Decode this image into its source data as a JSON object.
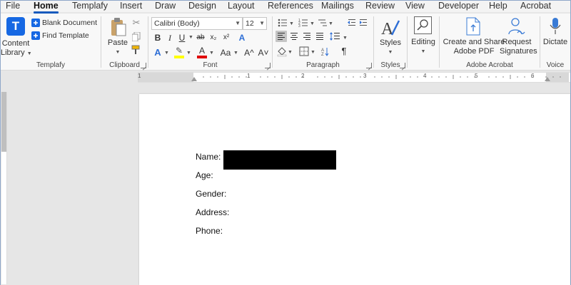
{
  "menu": {
    "tabs": [
      "File",
      "Home",
      "Templafy",
      "Insert",
      "Draw",
      "Design",
      "Layout",
      "References",
      "Mailings",
      "Review",
      "View",
      "Developer",
      "Help",
      "Acrobat"
    ],
    "active": "Home"
  },
  "ribbon": {
    "templafy": {
      "content_library_line1": "Content",
      "content_library_line2": "Library",
      "blank_document": "Blank Document",
      "find_template": "Find Template",
      "group_label": "Templafy"
    },
    "clipboard": {
      "paste": "Paste",
      "group_label": "Clipboard"
    },
    "font": {
      "font_name": "Calibri (Body)",
      "font_size": "12",
      "bold": "B",
      "italic": "I",
      "underline": "U",
      "strike": "ab",
      "subscript": "x₂",
      "superscript": "x²",
      "clear_formatting": "A",
      "text_effects": "A",
      "highlight": "✎",
      "font_color": "A",
      "change_case": "Aa",
      "grow": "A^",
      "shrink": "A˅",
      "group_label": "Font"
    },
    "paragraph": {
      "pilcrow": "¶",
      "group_label": "Paragraph"
    },
    "styles": {
      "label": "Styles",
      "group_label": "Styles"
    },
    "editing": {
      "label": "Editing"
    },
    "adobe": {
      "create_share_line1": "Create and Share",
      "create_share_line2": "Adobe PDF",
      "request_sig_line1": "Request",
      "request_sig_line2": "Signatures",
      "group_label": "Adobe Acrobat"
    },
    "voice": {
      "dictate": "Dictate",
      "group_label": "Voice"
    }
  },
  "ruler": {
    "numbers": [
      "1",
      "1",
      "2",
      "3",
      "4",
      "5",
      "6"
    ]
  },
  "document": {
    "fields": [
      "Name:",
      "Age:",
      "Gender:",
      "Address:",
      "Phone:"
    ]
  },
  "colors": {
    "accent": "#185abd",
    "templafy_blue": "#1668e3",
    "highlight_yellow": "#ffff00",
    "font_red": "#e00000"
  }
}
